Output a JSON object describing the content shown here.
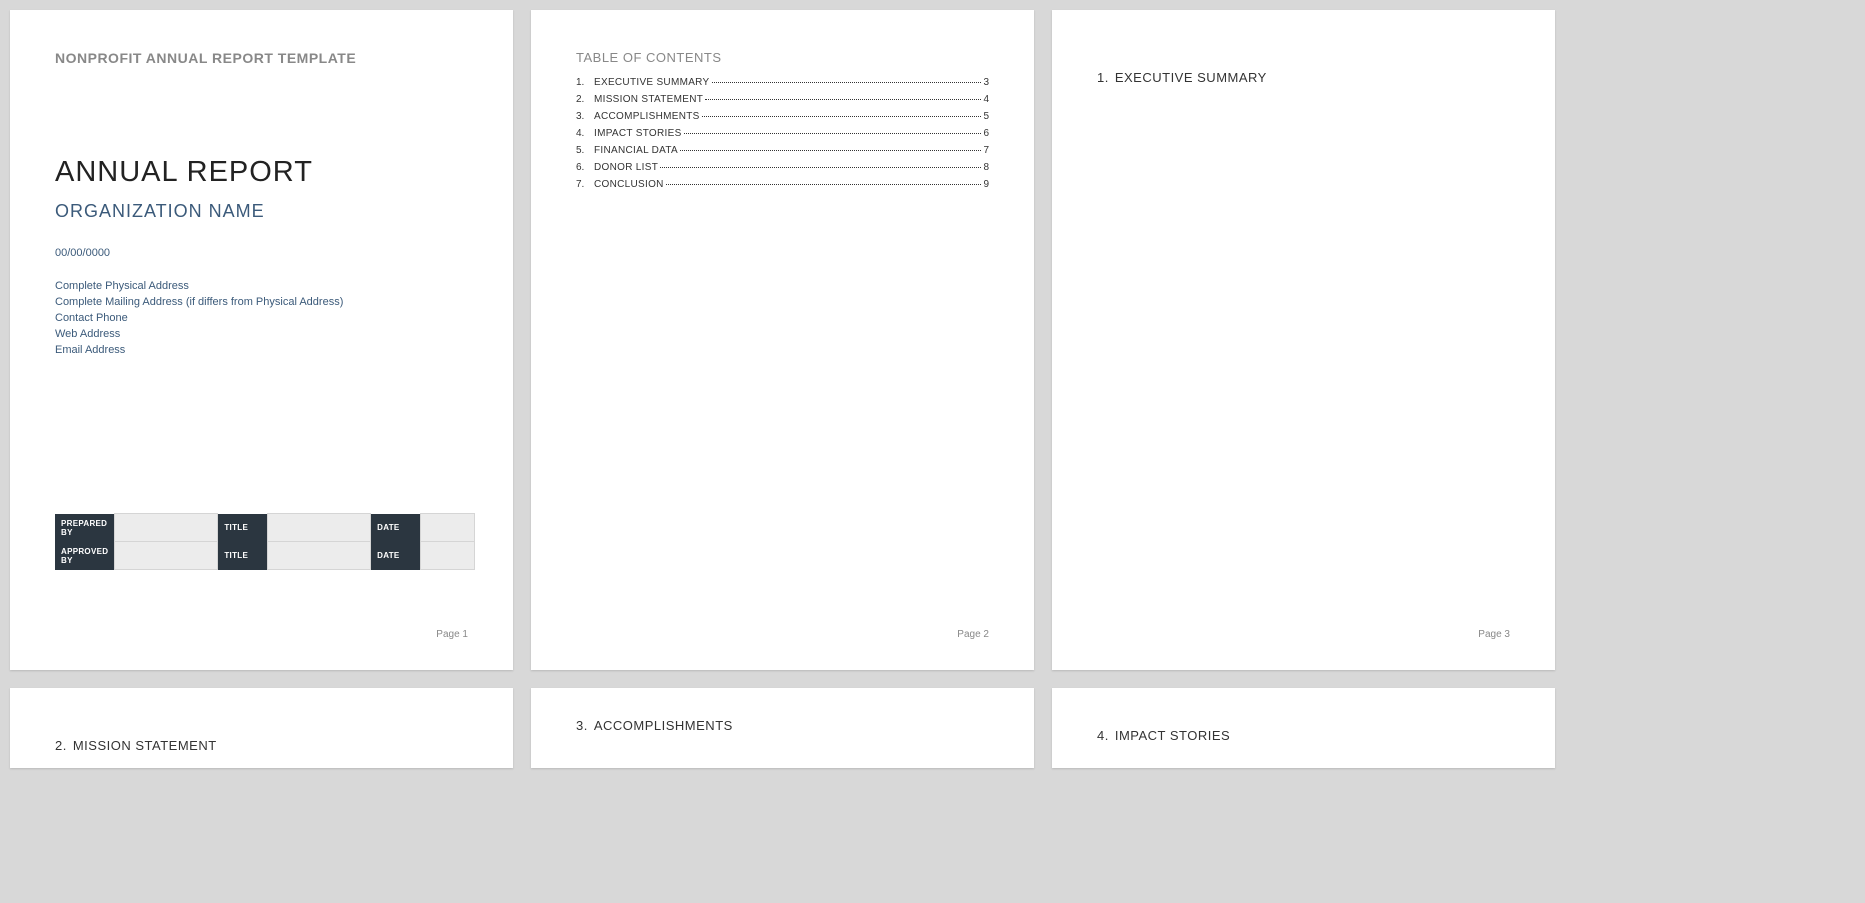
{
  "template_header": "NONPROFIT ANNUAL REPORT TEMPLATE",
  "cover": {
    "title": "ANNUAL REPORT",
    "org_name": "ORGANIZATION NAME",
    "date": "00/00/0000",
    "addr1": "Complete Physical Address",
    "addr2": "Complete Mailing Address (if differs from Physical Address)",
    "phone": "Contact Phone",
    "web": "Web Address",
    "email": "Email Address"
  },
  "sig": {
    "row1_label1": "PREPARED BY",
    "row1_label2": "TITLE",
    "row1_label3": "DATE",
    "row2_label1": "APPROVED BY",
    "row2_label2": "TITLE",
    "row2_label3": "DATE"
  },
  "toc_title": "TABLE OF CONTENTS",
  "toc": [
    {
      "num": "1.",
      "label": "EXECUTIVE SUMMARY",
      "page": "3"
    },
    {
      "num": "2.",
      "label": "MISSION STATEMENT",
      "page": "4"
    },
    {
      "num": "3.",
      "label": "ACCOMPLISHMENTS",
      "page": "5"
    },
    {
      "num": "4.",
      "label": "IMPACT STORIES",
      "page": "6"
    },
    {
      "num": "5.",
      "label": "FINANCIAL DATA",
      "page": "7"
    },
    {
      "num": "6.",
      "label": "DONOR LIST",
      "page": "8"
    },
    {
      "num": "7.",
      "label": "CONCLUSION",
      "page": "9"
    }
  ],
  "sections": {
    "p3_num": "1.",
    "p3_title": "EXECUTIVE SUMMARY",
    "p4_num": "2.",
    "p4_title": "MISSION STATEMENT",
    "p5_num": "3.",
    "p5_title": "ACCOMPLISHMENTS",
    "p6_num": "4.",
    "p6_title": "IMPACT STORIES"
  },
  "pagenum": {
    "p1": "Page 1",
    "p2": "Page 2",
    "p3": "Page 3"
  }
}
